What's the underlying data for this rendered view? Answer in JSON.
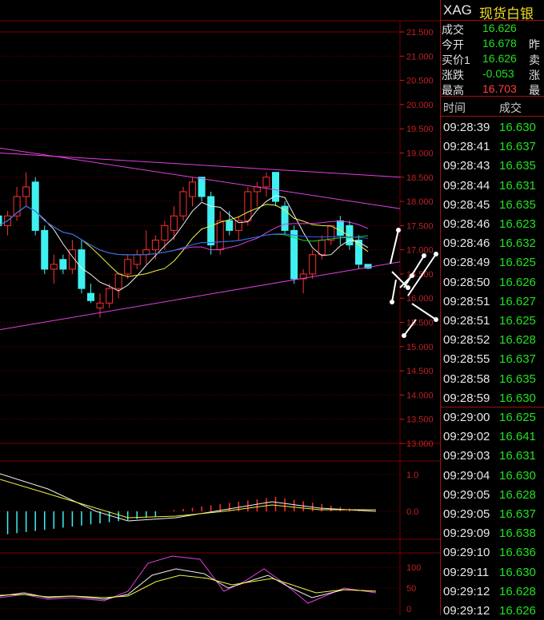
{
  "header": {
    "symbol": "XAG",
    "name": "现货白银"
  },
  "quotes": [
    {
      "label": "成交",
      "value": "16.626",
      "color": "#22e022",
      "right": ""
    },
    {
      "label": "今开",
      "value": "16.678",
      "color": "#22e022",
      "right": "昨"
    },
    {
      "label": "买价1",
      "value": "16.626",
      "color": "#22e022",
      "right": "卖"
    },
    {
      "label": "涨跌",
      "value": "-0.053",
      "color": "#22e022",
      "right": "涨"
    },
    {
      "label": "最高",
      "value": "16.703",
      "color": "#ff4040",
      "right": "最"
    }
  ],
  "ticks_header": {
    "time": "时间",
    "price": "成交"
  },
  "ticks": [
    {
      "time": "09:28:39",
      "price": "16.630"
    },
    {
      "time": "09:28:41",
      "price": "16.637"
    },
    {
      "time": "09:28:43",
      "price": "16.635"
    },
    {
      "time": "09:28:44",
      "price": "16.631"
    },
    {
      "time": "09:28:45",
      "price": "16.635"
    },
    {
      "time": "09:28:46",
      "price": "16.623"
    },
    {
      "time": "09:28:46",
      "price": "16.632"
    },
    {
      "time": "09:28:49",
      "price": "16.625"
    },
    {
      "time": "09:28:50",
      "price": "16.626"
    },
    {
      "time": "09:28:51",
      "price": "16.627"
    },
    {
      "time": "09:28:51",
      "price": "16.625"
    },
    {
      "time": "09:28:52",
      "price": "16.628"
    },
    {
      "time": "09:28:55",
      "price": "16.637"
    },
    {
      "time": "09:28:58",
      "price": "16.635"
    },
    {
      "time": "09:28:59",
      "price": "16.630"
    },
    {
      "time": "09:29:00",
      "price": "16.625"
    },
    {
      "time": "09:29:02",
      "price": "16.641"
    },
    {
      "time": "09:29:03",
      "price": "16.631"
    },
    {
      "time": "09:29:04",
      "price": "16.630"
    },
    {
      "time": "09:29:05",
      "price": "16.628"
    },
    {
      "time": "09:29:05",
      "price": "16.637"
    },
    {
      "time": "09:29:09",
      "price": "16.638"
    },
    {
      "time": "09:29:10",
      "price": "16.636"
    },
    {
      "time": "09:29:11",
      "price": "16.630"
    },
    {
      "time": "09:29:12",
      "price": "16.628"
    },
    {
      "time": "09:29:12",
      "price": "16.626"
    }
  ],
  "price_axis": {
    "labels": [
      "21.500",
      "21.000",
      "20.500",
      "20.000",
      "19.500",
      "19.000",
      "18.500",
      "18.000",
      "17.500",
      "17.000",
      "16.500",
      "16.000",
      "15.500",
      "15.000",
      "14.500",
      "14.000",
      "13.500",
      "13.000"
    ],
    "max": 21.5,
    "min": 13.0
  },
  "macd_axis": {
    "labels": [
      "1.0",
      "0.0"
    ]
  },
  "kdj_axis": {
    "labels": [
      "100",
      "50",
      "0"
    ]
  },
  "colors": {
    "up": "#ff3030",
    "down": "#40f0f0",
    "grid": "#7a0000",
    "axis_text": "#c02020",
    "trend": "#e040e0"
  },
  "chart_data": {
    "type": "candlestick",
    "candles": [
      [
        17.7,
        18.0,
        17.4,
        17.5
      ],
      [
        17.5,
        17.8,
        17.3,
        17.7
      ],
      [
        17.7,
        18.3,
        17.6,
        18.1
      ],
      [
        18.1,
        18.6,
        17.9,
        18.3
      ],
      [
        18.4,
        18.5,
        17.3,
        17.4
      ],
      [
        17.4,
        17.5,
        16.5,
        16.6
      ],
      [
        16.6,
        16.9,
        16.3,
        16.7
      ],
      [
        16.8,
        16.9,
        16.5,
        16.6
      ],
      [
        16.6,
        17.2,
        16.5,
        17.0
      ],
      [
        17.0,
        17.2,
        16.1,
        16.2
      ],
      [
        16.1,
        16.3,
        15.9,
        15.95
      ],
      [
        15.8,
        16.1,
        15.6,
        15.9
      ],
      [
        15.9,
        16.3,
        15.8,
        16.2
      ],
      [
        16.2,
        16.5,
        16.0,
        16.5
      ],
      [
        16.5,
        16.9,
        16.4,
        16.8
      ],
      [
        16.7,
        17.0,
        16.6,
        16.9
      ],
      [
        16.9,
        17.4,
        16.7,
        17.0
      ],
      [
        17.0,
        17.3,
        16.8,
        17.2
      ],
      [
        17.2,
        17.6,
        17.0,
        17.5
      ],
      [
        17.4,
        17.9,
        17.2,
        17.7
      ],
      [
        17.7,
        18.3,
        17.6,
        18.2
      ],
      [
        18.1,
        18.5,
        17.9,
        18.4
      ],
      [
        18.5,
        18.5,
        18.0,
        18.1
      ],
      [
        18.1,
        18.2,
        16.9,
        17.1
      ],
      [
        17.0,
        17.8,
        16.9,
        17.6
      ],
      [
        17.6,
        17.8,
        17.3,
        17.4
      ],
      [
        17.4,
        17.7,
        17.2,
        17.6
      ],
      [
        17.6,
        18.3,
        17.5,
        18.2
      ],
      [
        18.2,
        18.4,
        17.9,
        18.3
      ],
      [
        18.3,
        18.6,
        18.1,
        18.5
      ],
      [
        18.6,
        18.6,
        17.9,
        18.0
      ],
      [
        17.9,
        18.0,
        17.3,
        17.4
      ],
      [
        17.4,
        17.5,
        16.3,
        16.4
      ],
      [
        16.4,
        16.6,
        16.1,
        16.5
      ],
      [
        16.5,
        17.0,
        16.4,
        16.9
      ],
      [
        16.9,
        17.3,
        16.8,
        17.2
      ],
      [
        17.2,
        17.5,
        17.1,
        17.5
      ],
      [
        17.6,
        17.7,
        17.1,
        17.3
      ],
      [
        17.5,
        17.6,
        17.0,
        17.1
      ],
      [
        17.2,
        17.3,
        16.6,
        16.7
      ],
      [
        16.7,
        16.7,
        16.6,
        16.62
      ]
    ]
  }
}
